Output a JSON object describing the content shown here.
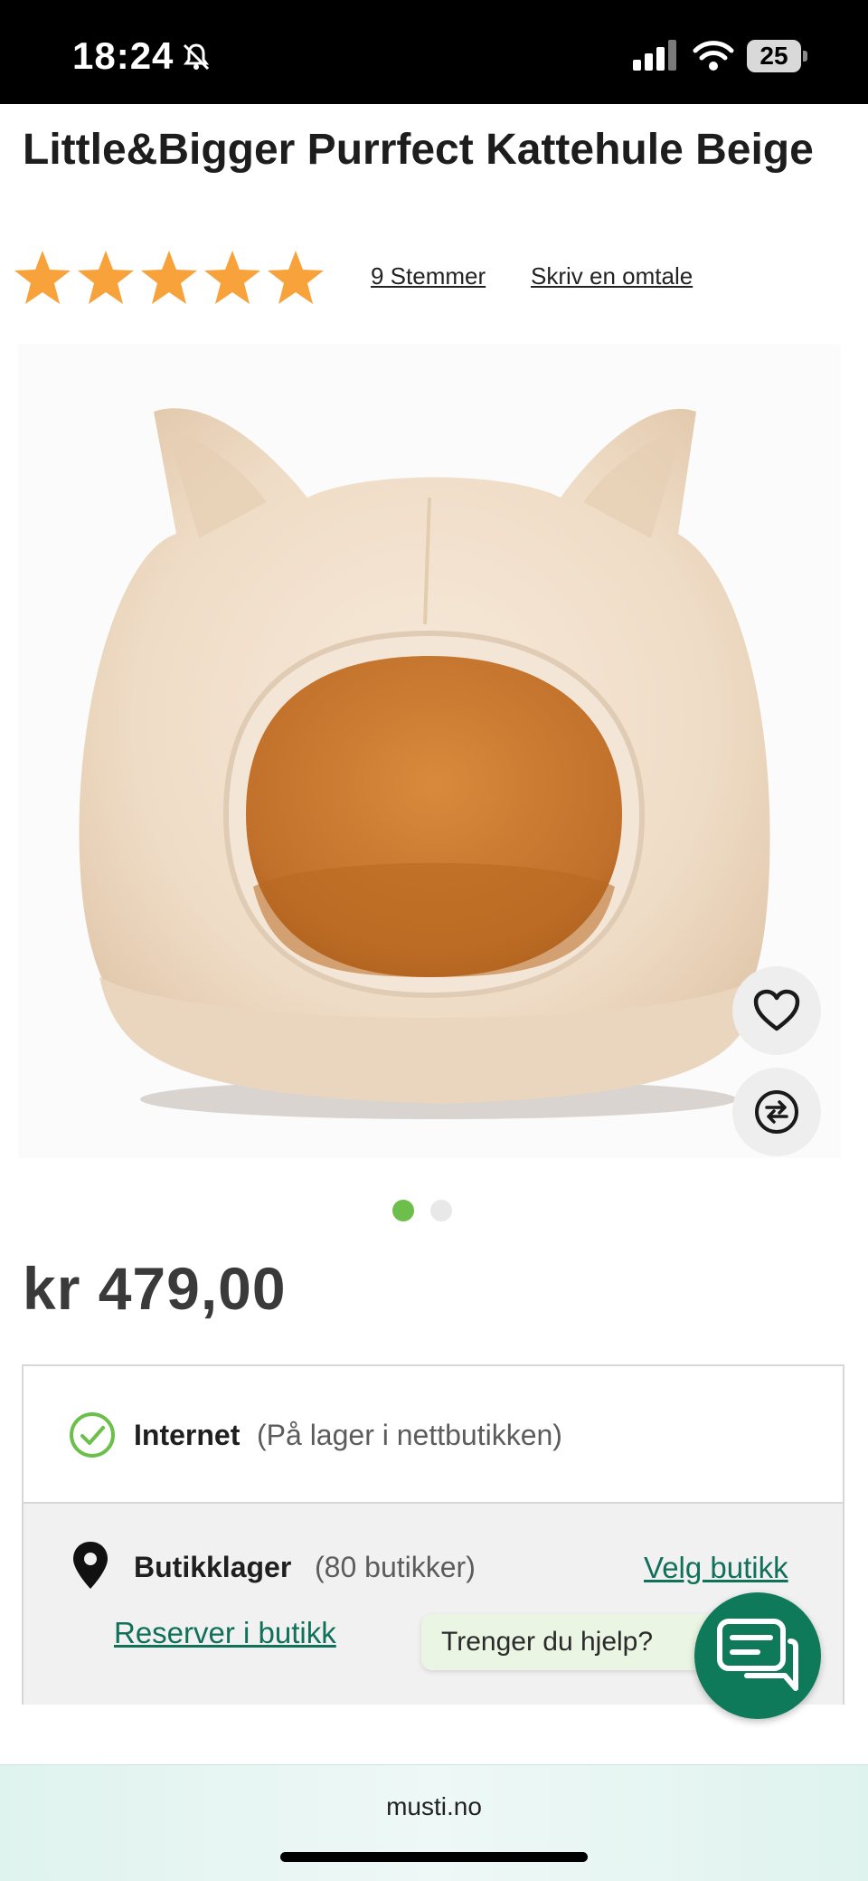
{
  "status_bar": {
    "time": "18:24",
    "battery": "25"
  },
  "product": {
    "title": "Little&Bigger Purrfect Kattehule Beige",
    "rating_stars": 5,
    "votes_label": "9 Stemmer",
    "review_link": "Skriv en omtale",
    "price": "kr 479,00",
    "gallery": {
      "total_images": 2,
      "active_index": 0
    }
  },
  "stock": {
    "internet_label": "Internet",
    "internet_note": "(På lager i nettbutikken)",
    "store_label": "Butikklager",
    "store_note": "(80 butikker)",
    "choose_store": "Velg butikk",
    "reserve_link": "Reserver i butikk"
  },
  "help": {
    "prompt": "Trenger du hjelp?"
  },
  "browser": {
    "url": "musti.no"
  },
  "colors": {
    "accent_green": "#10705a",
    "star": "#f7a23a",
    "dot_active": "#6cbf4b",
    "chat_button": "#0f7a5a"
  },
  "icons": [
    "bell-off-icon",
    "signal-icon",
    "wifi-icon",
    "battery-icon",
    "star-icon",
    "heart-icon",
    "compare-icon",
    "check-circle-icon",
    "location-pin-icon",
    "chat-icon"
  ]
}
